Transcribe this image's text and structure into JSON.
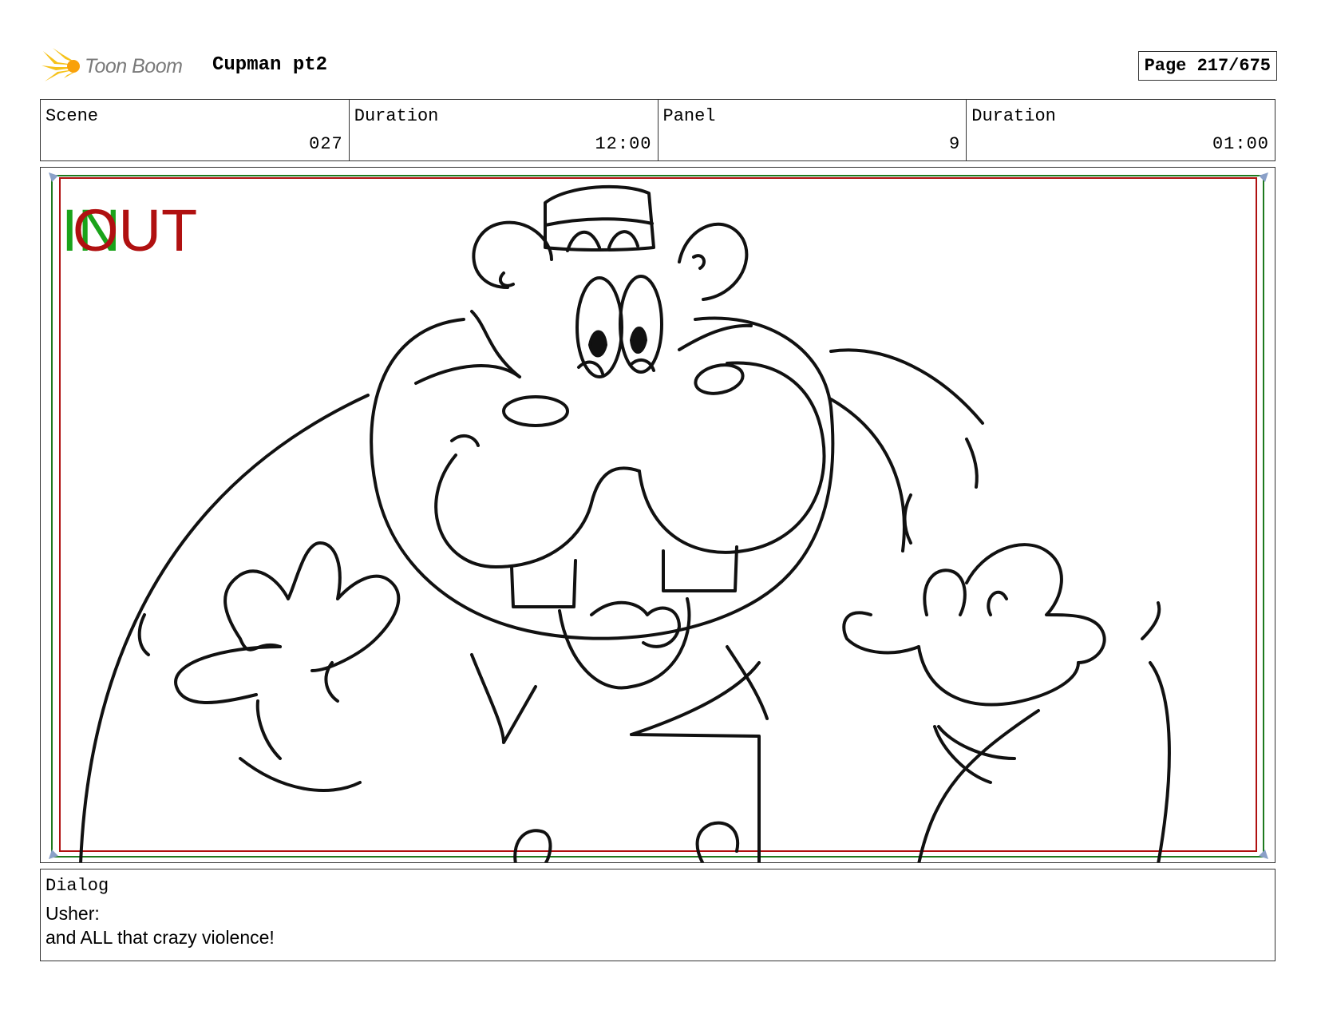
{
  "header": {
    "logo_text": "Toon Boom",
    "project_title": "Cupman pt2",
    "page_label": "Page 217/675"
  },
  "info": {
    "scene_label": "Scene",
    "scene_value": "027",
    "scene_duration_label": "Duration",
    "scene_duration_value": "12:00",
    "panel_label": "Panel",
    "panel_value": "9",
    "panel_duration_label": "Duration",
    "panel_duration_value": "01:00"
  },
  "panel": {
    "in_marker": "IN",
    "out_marker": "OUT",
    "in_color": "#1aa31a",
    "out_color": "#b01010"
  },
  "dialog": {
    "label": "Dialog",
    "speaker": "Usher:",
    "line": "and ALL that crazy violence!"
  },
  "icons": [
    "toon-boom-logo-icon"
  ]
}
